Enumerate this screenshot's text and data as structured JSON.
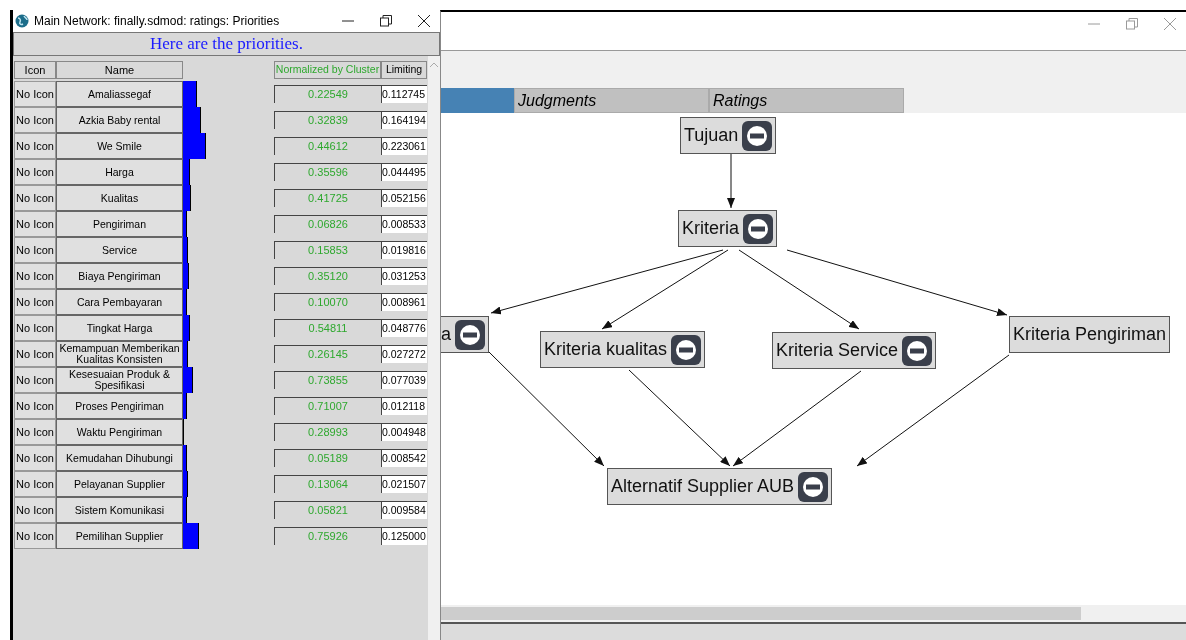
{
  "priorities_window": {
    "title": "Main Network: finally.sdmod: ratings: Priorities",
    "heading": "Here are the priorities.",
    "columns": {
      "icon": "Icon",
      "name": "Name",
      "normalized": "Normalized by Cluster",
      "limiting": "Limiting"
    },
    "rows": [
      {
        "icon": "No Icon",
        "name": "Amaliassegaf",
        "normalized": "0.22549",
        "limiting": "0.112745"
      },
      {
        "icon": "No Icon",
        "name": "Azkia Baby rental",
        "normalized": "0.32839",
        "limiting": "0.164194"
      },
      {
        "icon": "No Icon",
        "name": "We Smile",
        "normalized": "0.44612",
        "limiting": "0.223061"
      },
      {
        "icon": "No Icon",
        "name": "Harga",
        "normalized": "0.35596",
        "limiting": "0.044495"
      },
      {
        "icon": "No Icon",
        "name": "Kualitas",
        "normalized": "0.41725",
        "limiting": "0.052156"
      },
      {
        "icon": "No Icon",
        "name": "Pengiriman",
        "normalized": "0.06826",
        "limiting": "0.008533"
      },
      {
        "icon": "No Icon",
        "name": "Service",
        "normalized": "0.15853",
        "limiting": "0.019816"
      },
      {
        "icon": "No Icon",
        "name": "Biaya Pengiriman",
        "normalized": "0.35120",
        "limiting": "0.031253"
      },
      {
        "icon": "No Icon",
        "name": "Cara Pembayaran",
        "normalized": "0.10070",
        "limiting": "0.008961"
      },
      {
        "icon": "No Icon",
        "name": "Tingkat Harga",
        "normalized": "0.54811",
        "limiting": "0.048776"
      },
      {
        "icon": "No Icon",
        "name": "Kemampuan Memberikan Kualitas Konsisten",
        "normalized": "0.26145",
        "limiting": "0.027272"
      },
      {
        "icon": "No Icon",
        "name": "Kesesuaian Produk & Spesifikasi",
        "normalized": "0.73855",
        "limiting": "0.077039"
      },
      {
        "icon": "No Icon",
        "name": "Proses Pengiriman",
        "normalized": "0.71007",
        "limiting": "0.012118"
      },
      {
        "icon": "No Icon",
        "name": "Waktu Pengiriman",
        "normalized": "0.28993",
        "limiting": "0.004948"
      },
      {
        "icon": "No Icon",
        "name": "Kemudahan Dihubungi",
        "normalized": "0.05189",
        "limiting": "0.008542"
      },
      {
        "icon": "No Icon",
        "name": "Pelayanan Supplier",
        "normalized": "0.13064",
        "limiting": "0.021507"
      },
      {
        "icon": "No Icon",
        "name": "Sistem Komunikasi",
        "normalized": "0.05821",
        "limiting": "0.009584"
      },
      {
        "icon": "No Icon",
        "name": "Pemilihan Supplier",
        "normalized": "0.75926",
        "limiting": "0.125000"
      }
    ]
  },
  "main_window": {
    "tabs": [
      {
        "label": "Judgments",
        "selected": false
      },
      {
        "label": "Ratings",
        "selected": false
      }
    ],
    "nodes": [
      {
        "label": "Tujuan",
        "collapse_button": true
      },
      {
        "label": "Kriteria",
        "collapse_button": true
      },
      {
        "label": "a",
        "collapse_button": true
      },
      {
        "label": "Kriteria kualitas",
        "collapse_button": true
      },
      {
        "label": "Kriteria Service",
        "collapse_button": true
      },
      {
        "label": "Kriteria Pengiriman",
        "collapse_button": false
      },
      {
        "label": "Alternatif Supplier AUB",
        "collapse_button": true
      }
    ]
  }
}
